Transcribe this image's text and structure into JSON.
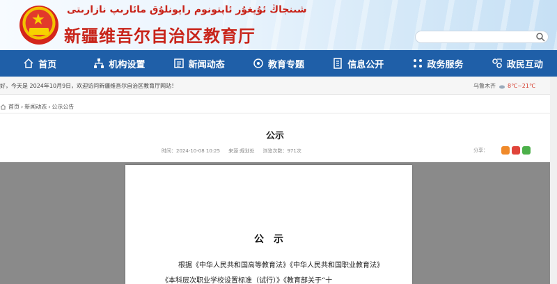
{
  "header": {
    "uyghur_title": "شىنجاڭ ئۇيغۇر ئاپتونوم رايونلۇق مائارىپ نازارىتى",
    "site_title": "新疆维吾尔自治区教育厅",
    "search_placeholder": ""
  },
  "nav": {
    "items": [
      {
        "label": "首页",
        "icon": "home-icon"
      },
      {
        "label": "机构设置",
        "icon": "org-chart-icon"
      },
      {
        "label": "新闻动态",
        "icon": "news-icon"
      },
      {
        "label": "教育专题",
        "icon": "topic-icon"
      },
      {
        "label": "信息公开",
        "icon": "info-doc-icon"
      },
      {
        "label": "政务服务",
        "icon": "service-icon"
      },
      {
        "label": "政民互动",
        "icon": "interaction-icon"
      }
    ]
  },
  "greeting": {
    "message": "好，今天是 2024年10月9日，欢迎访问新疆维吾尔自治区教育厅网站！",
    "city": "乌鲁木齐",
    "temperature": "8℃~21℃"
  },
  "breadcrumb": {
    "items": [
      "首页",
      "新闻动态",
      "公示公告"
    ],
    "separator": "›"
  },
  "article": {
    "title": "公示",
    "time": "时间：2024-10-08 10:25",
    "source": "来源:规划处",
    "views": "浏览次数：971次",
    "share_label": "分享："
  },
  "document": {
    "heading": "公示",
    "paragraph": "根据《中华人民共和国高等教育法》《中华人民共和国职业教育法》《本科层次职业学校设置标准（试行）》《教育部关于“十"
  },
  "colors": {
    "nav_bg": "#1f5fa8",
    "title_red": "#c8241a",
    "viewer_bg": "#8a8a8a"
  }
}
